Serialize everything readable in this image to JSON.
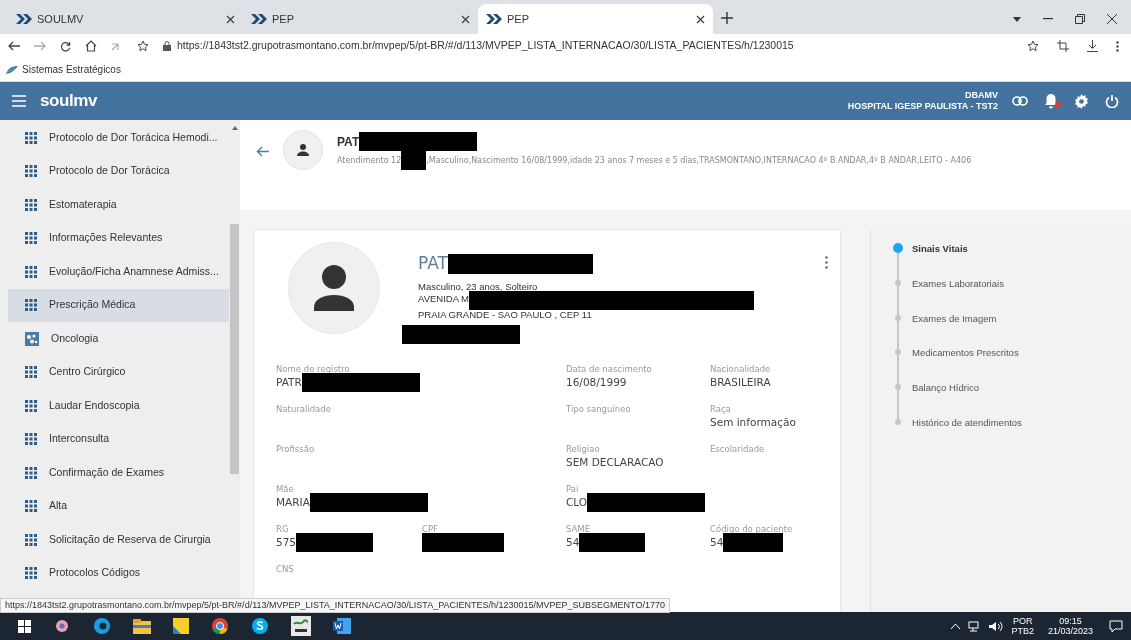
{
  "browser": {
    "tabs": [
      {
        "title": "SOULMV",
        "selected": false
      },
      {
        "title": "PEP",
        "selected": false
      },
      {
        "title": "PEP",
        "selected": true
      }
    ],
    "url": "https://1843tst2.grupotrasmontano.com.br/mvpep/5/pt-BR/#/d/113/MVPEP_LISTA_INTERNACAO/30/LISTA_PACIENTES/h/1230015",
    "bookmarks": [
      "Sistemas Estratégicos"
    ],
    "status_url": "https://1843tst2.grupotrasmontano.com.br/mvpep/5/pt-BR/#/d/113/MVPEP_LISTA_INTERNACAO/30/LISTA_PACIENTES/h/1230015/MVPEP_SUBSEGMENTO/1770"
  },
  "app": {
    "logo": "soulmv",
    "user": "DBAMV",
    "hospital": "HOSPITAL IGESP PAULISTA - TST2",
    "notification": true
  },
  "sidebar": {
    "items": [
      {
        "label": "Protocolo de Dor Torácica Hemodi...",
        "kind": "grid",
        "selected": false
      },
      {
        "label": "Protocolo de Dor Torácica",
        "kind": "grid",
        "selected": false
      },
      {
        "label": "Estomaterapia",
        "kind": "grid",
        "selected": false
      },
      {
        "label": "Informações Relevantes",
        "kind": "grid",
        "selected": false
      },
      {
        "label": "Evolução/Ficha Anamnese Admiss...",
        "kind": "grid",
        "selected": false
      },
      {
        "label": "Prescrição Médica",
        "kind": "grid",
        "selected": true
      },
      {
        "label": "Oncologia",
        "kind": "dots",
        "selected": false
      },
      {
        "label": "Centro Cirúrgico",
        "kind": "grid",
        "selected": false
      },
      {
        "label": "Laudar Endoscopia",
        "kind": "grid",
        "selected": false
      },
      {
        "label": "Interconsulta",
        "kind": "grid",
        "selected": false
      },
      {
        "label": "Confirmação de Exames",
        "kind": "grid",
        "selected": false
      },
      {
        "label": "Alta",
        "kind": "grid",
        "selected": false
      },
      {
        "label": "Solicitação de Reserva de Cirurgia",
        "kind": "grid",
        "selected": false
      },
      {
        "label": "Protocolos Códigos",
        "kind": "grid",
        "selected": false
      }
    ]
  },
  "patient_header": {
    "name": "PAT",
    "info_start": "Atendimento 12",
    "info_end": ",Masculino,Nascimento 16/08/1999,idade 23 anos 7 meses e 5 dias,TRASMONTANO,INTERNACAO 4º B ANDAR,4º B ANDAR,LEITO - A406"
  },
  "card": {
    "name": "PAT",
    "summary": "Masculino, 23 anos, Solteiro",
    "address_1": "AVENIDA M",
    "address_2": "PRAIA GRANDE - SAO PAULO , CEP 11",
    "rows": [
      {
        "cells": [
          {
            "kind": "field",
            "label": "Nome de registro",
            "value": "PATR",
            "redacted": true
          },
          {
            "kind": "blank"
          },
          {
            "kind": "field",
            "label": "Data de nascimento",
            "value": "16/08/1999"
          },
          {
            "kind": "field",
            "label": "Nacionalidade",
            "value": "BRASILEIRA"
          }
        ]
      },
      {
        "cells": [
          {
            "kind": "field",
            "label": "Naturalidade"
          },
          {
            "kind": "blank"
          },
          {
            "kind": "field",
            "label": "Tipo sanguíneo"
          },
          {
            "kind": "field",
            "label": "Raça",
            "value": "Sem informação"
          }
        ]
      },
      {
        "cells": [
          {
            "kind": "field",
            "label": "Profissão"
          },
          {
            "kind": "blank"
          },
          {
            "kind": "field",
            "label": "Religiao",
            "value": "SEM DECLARACAO"
          },
          {
            "kind": "field",
            "label": "Escolaridade"
          }
        ]
      },
      {
        "cells": [
          {
            "kind": "field",
            "label": "Mãe",
            "value": "MARIA",
            "redacted": true
          },
          {
            "kind": "blank"
          },
          {
            "kind": "field",
            "label": "Pai",
            "value": "CLO",
            "redacted": true
          },
          {
            "kind": "blank"
          }
        ]
      },
      {
        "cells": [
          {
            "kind": "field",
            "label": "RG",
            "value": "575",
            "redacted": true
          },
          {
            "kind": "field",
            "label": "CPF",
            "redacted": true
          },
          {
            "kind": "field",
            "label": "SAME",
            "value": "54",
            "redacted": true
          },
          {
            "kind": "field",
            "label": "Código do paciente",
            "value": "54",
            "redacted": true
          }
        ]
      },
      {
        "cells": [
          {
            "kind": "field",
            "label": "CNS"
          }
        ]
      }
    ]
  },
  "timeline": [
    {
      "label": "Sinais Vitais",
      "selected": true
    },
    {
      "label": "Exames Laboratoriais",
      "selected": false
    },
    {
      "label": "Exames de Imagem",
      "selected": false
    },
    {
      "label": "Medicamentos Prescritos",
      "selected": false
    },
    {
      "label": "Balanço Hídrico",
      "selected": false
    },
    {
      "label": "Histórico de atendimentos",
      "selected": false
    }
  ],
  "taskbar": {
    "language": "POR",
    "layout": "PTB2",
    "time": "09:15",
    "date": "21/03/2023"
  }
}
